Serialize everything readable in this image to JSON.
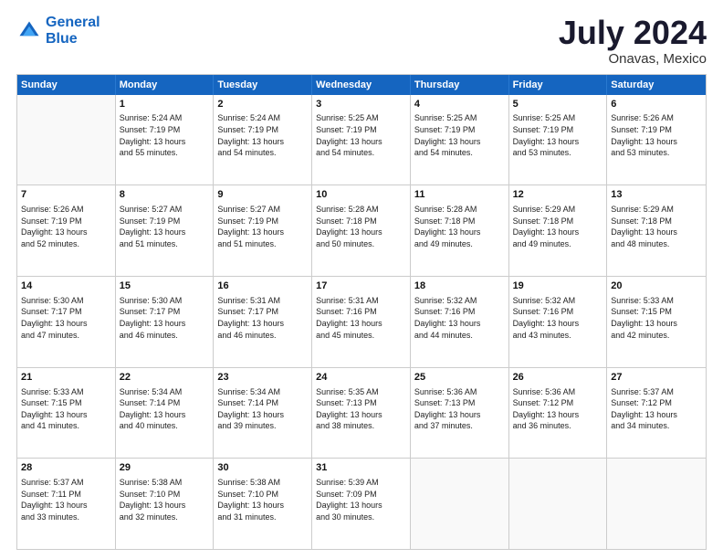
{
  "logo": {
    "line1": "General",
    "line2": "Blue"
  },
  "title": "July 2024",
  "location": "Onavas, Mexico",
  "days": [
    "Sunday",
    "Monday",
    "Tuesday",
    "Wednesday",
    "Thursday",
    "Friday",
    "Saturday"
  ],
  "rows": [
    [
      {
        "day": "",
        "lines": []
      },
      {
        "day": "1",
        "lines": [
          "Sunrise: 5:24 AM",
          "Sunset: 7:19 PM",
          "Daylight: 13 hours",
          "and 55 minutes."
        ]
      },
      {
        "day": "2",
        "lines": [
          "Sunrise: 5:24 AM",
          "Sunset: 7:19 PM",
          "Daylight: 13 hours",
          "and 54 minutes."
        ]
      },
      {
        "day": "3",
        "lines": [
          "Sunrise: 5:25 AM",
          "Sunset: 7:19 PM",
          "Daylight: 13 hours",
          "and 54 minutes."
        ]
      },
      {
        "day": "4",
        "lines": [
          "Sunrise: 5:25 AM",
          "Sunset: 7:19 PM",
          "Daylight: 13 hours",
          "and 54 minutes."
        ]
      },
      {
        "day": "5",
        "lines": [
          "Sunrise: 5:25 AM",
          "Sunset: 7:19 PM",
          "Daylight: 13 hours",
          "and 53 minutes."
        ]
      },
      {
        "day": "6",
        "lines": [
          "Sunrise: 5:26 AM",
          "Sunset: 7:19 PM",
          "Daylight: 13 hours",
          "and 53 minutes."
        ]
      }
    ],
    [
      {
        "day": "7",
        "lines": [
          "Sunrise: 5:26 AM",
          "Sunset: 7:19 PM",
          "Daylight: 13 hours",
          "and 52 minutes."
        ]
      },
      {
        "day": "8",
        "lines": [
          "Sunrise: 5:27 AM",
          "Sunset: 7:19 PM",
          "Daylight: 13 hours",
          "and 51 minutes."
        ]
      },
      {
        "day": "9",
        "lines": [
          "Sunrise: 5:27 AM",
          "Sunset: 7:19 PM",
          "Daylight: 13 hours",
          "and 51 minutes."
        ]
      },
      {
        "day": "10",
        "lines": [
          "Sunrise: 5:28 AM",
          "Sunset: 7:18 PM",
          "Daylight: 13 hours",
          "and 50 minutes."
        ]
      },
      {
        "day": "11",
        "lines": [
          "Sunrise: 5:28 AM",
          "Sunset: 7:18 PM",
          "Daylight: 13 hours",
          "and 49 minutes."
        ]
      },
      {
        "day": "12",
        "lines": [
          "Sunrise: 5:29 AM",
          "Sunset: 7:18 PM",
          "Daylight: 13 hours",
          "and 49 minutes."
        ]
      },
      {
        "day": "13",
        "lines": [
          "Sunrise: 5:29 AM",
          "Sunset: 7:18 PM",
          "Daylight: 13 hours",
          "and 48 minutes."
        ]
      }
    ],
    [
      {
        "day": "14",
        "lines": [
          "Sunrise: 5:30 AM",
          "Sunset: 7:17 PM",
          "Daylight: 13 hours",
          "and 47 minutes."
        ]
      },
      {
        "day": "15",
        "lines": [
          "Sunrise: 5:30 AM",
          "Sunset: 7:17 PM",
          "Daylight: 13 hours",
          "and 46 minutes."
        ]
      },
      {
        "day": "16",
        "lines": [
          "Sunrise: 5:31 AM",
          "Sunset: 7:17 PM",
          "Daylight: 13 hours",
          "and 46 minutes."
        ]
      },
      {
        "day": "17",
        "lines": [
          "Sunrise: 5:31 AM",
          "Sunset: 7:16 PM",
          "Daylight: 13 hours",
          "and 45 minutes."
        ]
      },
      {
        "day": "18",
        "lines": [
          "Sunrise: 5:32 AM",
          "Sunset: 7:16 PM",
          "Daylight: 13 hours",
          "and 44 minutes."
        ]
      },
      {
        "day": "19",
        "lines": [
          "Sunrise: 5:32 AM",
          "Sunset: 7:16 PM",
          "Daylight: 13 hours",
          "and 43 minutes."
        ]
      },
      {
        "day": "20",
        "lines": [
          "Sunrise: 5:33 AM",
          "Sunset: 7:15 PM",
          "Daylight: 13 hours",
          "and 42 minutes."
        ]
      }
    ],
    [
      {
        "day": "21",
        "lines": [
          "Sunrise: 5:33 AM",
          "Sunset: 7:15 PM",
          "Daylight: 13 hours",
          "and 41 minutes."
        ]
      },
      {
        "day": "22",
        "lines": [
          "Sunrise: 5:34 AM",
          "Sunset: 7:14 PM",
          "Daylight: 13 hours",
          "and 40 minutes."
        ]
      },
      {
        "day": "23",
        "lines": [
          "Sunrise: 5:34 AM",
          "Sunset: 7:14 PM",
          "Daylight: 13 hours",
          "and 39 minutes."
        ]
      },
      {
        "day": "24",
        "lines": [
          "Sunrise: 5:35 AM",
          "Sunset: 7:13 PM",
          "Daylight: 13 hours",
          "and 38 minutes."
        ]
      },
      {
        "day": "25",
        "lines": [
          "Sunrise: 5:36 AM",
          "Sunset: 7:13 PM",
          "Daylight: 13 hours",
          "and 37 minutes."
        ]
      },
      {
        "day": "26",
        "lines": [
          "Sunrise: 5:36 AM",
          "Sunset: 7:12 PM",
          "Daylight: 13 hours",
          "and 36 minutes."
        ]
      },
      {
        "day": "27",
        "lines": [
          "Sunrise: 5:37 AM",
          "Sunset: 7:12 PM",
          "Daylight: 13 hours",
          "and 34 minutes."
        ]
      }
    ],
    [
      {
        "day": "28",
        "lines": [
          "Sunrise: 5:37 AM",
          "Sunset: 7:11 PM",
          "Daylight: 13 hours",
          "and 33 minutes."
        ]
      },
      {
        "day": "29",
        "lines": [
          "Sunrise: 5:38 AM",
          "Sunset: 7:10 PM",
          "Daylight: 13 hours",
          "and 32 minutes."
        ]
      },
      {
        "day": "30",
        "lines": [
          "Sunrise: 5:38 AM",
          "Sunset: 7:10 PM",
          "Daylight: 13 hours",
          "and 31 minutes."
        ]
      },
      {
        "day": "31",
        "lines": [
          "Sunrise: 5:39 AM",
          "Sunset: 7:09 PM",
          "Daylight: 13 hours",
          "and 30 minutes."
        ]
      },
      {
        "day": "",
        "lines": []
      },
      {
        "day": "",
        "lines": []
      },
      {
        "day": "",
        "lines": []
      }
    ]
  ]
}
